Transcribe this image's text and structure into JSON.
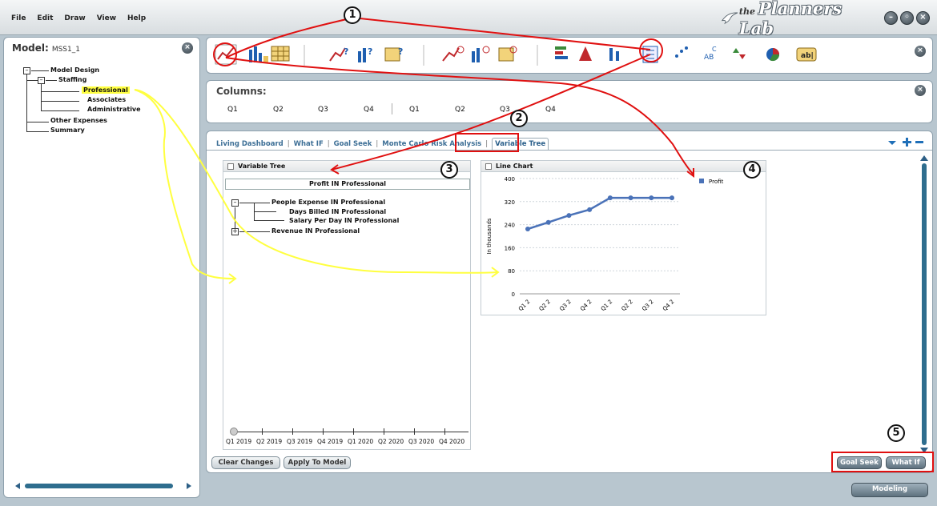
{
  "menu": [
    "File",
    "Edit",
    "Draw",
    "View",
    "Help"
  ],
  "brand": {
    "prefix": "the",
    "name": "Planners Lab"
  },
  "model": {
    "label": "Model:",
    "name": "MSS1_1"
  },
  "tree": {
    "root": "Model Design",
    "staffing": "Staffing",
    "professional": "Professional",
    "associates": "Associates",
    "administrative": "Administrative",
    "other": "Other Expenses",
    "summary": "Summary"
  },
  "columns": {
    "title": "Columns:",
    "items": [
      "Q1",
      "Q2",
      "Q3",
      "Q4",
      "Q1",
      "Q2",
      "Q3",
      "Q4"
    ]
  },
  "tabs": [
    "Living Dashboard",
    "What IF",
    "Goal Seek",
    "Monte Carlo Risk Analysis",
    "Variable Tree"
  ],
  "variable_tree": {
    "header": "Variable Tree",
    "root": "Profit IN Professional",
    "people": "People Expense IN Professional",
    "days": "Days Billed IN Professional",
    "salary": "Salary Per Day IN Professional",
    "revenue": "Revenue IN Professional",
    "timeline": [
      "Q1 2019",
      "Q2 2019",
      "Q3 2019",
      "Q4 2019",
      "Q1 2020",
      "Q2 2020",
      "Q3 2020",
      "Q4 2020"
    ]
  },
  "chart_data": {
    "type": "line",
    "title": "Line Chart",
    "ylabel": "In thousands",
    "xlabel": "",
    "categories": [
      "Q1 2",
      "Q2 2",
      "Q3 2",
      "Q4 2",
      "Q1 2",
      "Q2 2",
      "Q3 2",
      "Q4 2"
    ],
    "series": [
      {
        "name": "Profit",
        "values": [
          225,
          248,
          272,
          292,
          333,
          333,
          333,
          333
        ]
      }
    ],
    "ylim": [
      0,
      400
    ],
    "yticks": [
      0,
      80,
      160,
      240,
      320,
      400
    ],
    "grid": true,
    "legend": "top-right",
    "color": "#4a72b8"
  },
  "buttons": {
    "clear": "Clear Changes",
    "apply": "Apply To Model",
    "goal": "Goal Seek",
    "whatif": "What If",
    "modeling": "Modeling"
  },
  "annotations": [
    "1",
    "2",
    "3",
    "4",
    "5"
  ],
  "colors": {
    "annotation_red": "#e01010",
    "annotation_yellow": "#ffff40",
    "highlight": "#ffff40"
  }
}
